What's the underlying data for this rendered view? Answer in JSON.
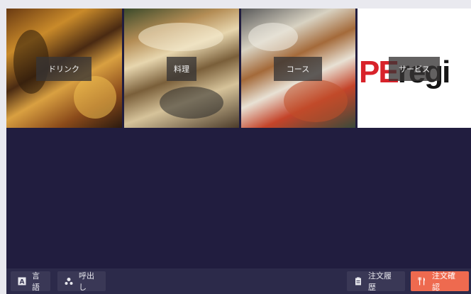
{
  "menu": {
    "tiles": [
      {
        "label": "ドリンク"
      },
      {
        "label": "料理"
      },
      {
        "label": "コース"
      },
      {
        "label": "サービス"
      }
    ],
    "logo_parts": [
      "PE",
      "regi"
    ]
  },
  "footer": {
    "language_label": "言語",
    "call_label": "呼出し",
    "history_label": "注文履歴",
    "confirm_label": "注文確認"
  },
  "colors": {
    "background": "#211d3f",
    "bottom_bar": "#2c2a4a",
    "accent": "#ee6a4f",
    "logo_red": "#d8222a"
  },
  "icons": [
    "language-icon",
    "call-staff-icon",
    "order-history-icon",
    "utensils-icon"
  ]
}
